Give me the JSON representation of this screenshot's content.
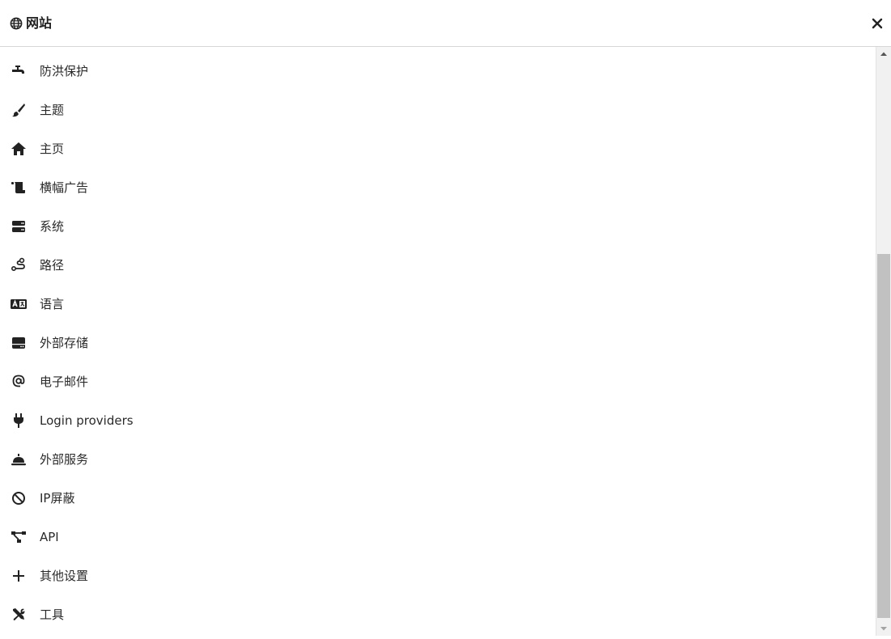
{
  "header": {
    "title": "网站",
    "icon": "globe-icon",
    "close_icon": "close-icon"
  },
  "menu": {
    "items": [
      {
        "label": "防洪保护",
        "icon": "faucet-icon"
      },
      {
        "label": "主题",
        "icon": "paintbrush-icon"
      },
      {
        "label": "主页",
        "icon": "home-icon"
      },
      {
        "label": "横幅广告",
        "icon": "scroll-icon"
      },
      {
        "label": "系统",
        "icon": "server-icon"
      },
      {
        "label": "路径",
        "icon": "route-icon"
      },
      {
        "label": "语言",
        "icon": "language-icon"
      },
      {
        "label": "外部存储",
        "icon": "hdd-icon"
      },
      {
        "label": "电子邮件",
        "icon": "at-sign-icon"
      },
      {
        "label": "Login providers",
        "icon": "plug-icon"
      },
      {
        "label": "外部服务",
        "icon": "concierge-bell-icon"
      },
      {
        "label": "IP屏蔽",
        "icon": "ban-icon"
      },
      {
        "label": "API",
        "icon": "project-diagram-icon"
      },
      {
        "label": "其他设置",
        "icon": "plus-icon"
      },
      {
        "label": "工具",
        "icon": "tools-icon"
      }
    ]
  },
  "scrollbar": {
    "position_fraction": 0.35
  }
}
